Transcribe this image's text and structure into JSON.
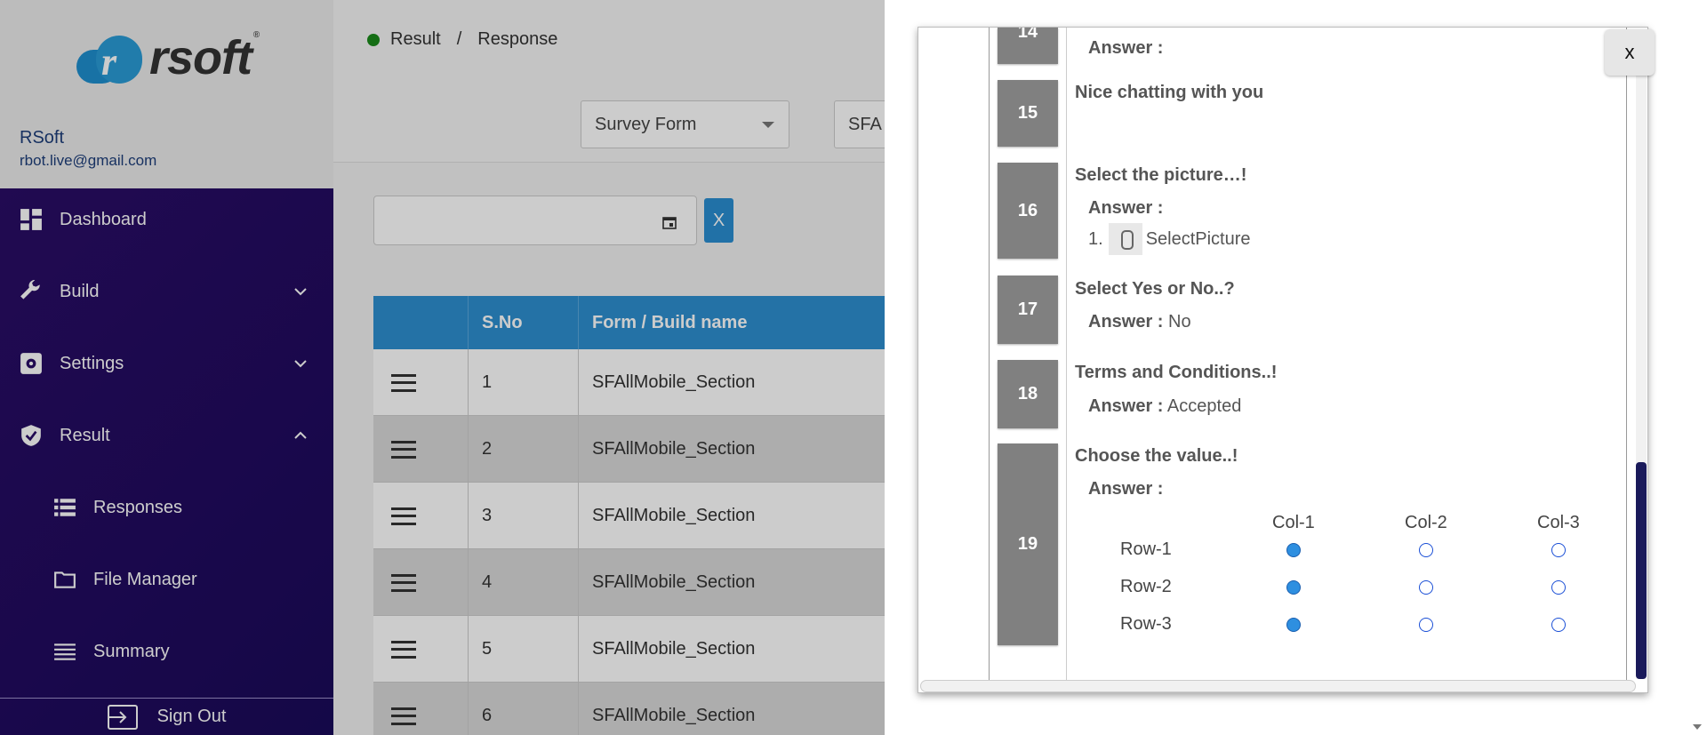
{
  "sidebar": {
    "logo_text": "rsoft",
    "logo_letter": "r",
    "logo_reg": "®",
    "user_name": "RSoft",
    "user_email": "rbot.live@gmail.com",
    "items": [
      {
        "label": "Dashboard",
        "icon": "dashboard-icon"
      },
      {
        "label": "Build",
        "icon": "wrench-icon",
        "chevron": "down"
      },
      {
        "label": "Settings",
        "icon": "gear-icon",
        "chevron": "down"
      },
      {
        "label": "Result",
        "icon": "shield-icon",
        "chevron": "up"
      }
    ],
    "sub_items": [
      {
        "label": "Responses",
        "icon": "table-icon"
      },
      {
        "label": "File Manager",
        "icon": "folder-icon"
      },
      {
        "label": "Summary",
        "icon": "list-icon"
      }
    ],
    "signout_label": "Sign Out",
    "accent": "#2a0d66"
  },
  "breadcrumb": {
    "root": "Result",
    "separator": "/",
    "current": "Response"
  },
  "filters": {
    "form_type": "Survey Form",
    "form_name": "SFA",
    "clear_label": "X"
  },
  "table": {
    "headers": [
      "",
      "S.No",
      "Form / Build name"
    ],
    "rows": [
      {
        "sno": "1",
        "name": "SFAllMobile_Section"
      },
      {
        "sno": "2",
        "name": "SFAllMobile_Section"
      },
      {
        "sno": "3",
        "name": "SFAllMobile_Section"
      },
      {
        "sno": "4",
        "name": "SFAllMobile_Section"
      },
      {
        "sno": "5",
        "name": "SFAllMobile_Section"
      },
      {
        "sno": "6",
        "name": "SFAllMobile_Section"
      }
    ],
    "header_color": "#2e8fd0"
  },
  "modal": {
    "close_label": "x",
    "questions": [
      {
        "num": "14",
        "answer_label": "Answer :"
      },
      {
        "num": "15",
        "title": "Nice chatting with you"
      },
      {
        "num": "16",
        "title": "Select the picture…!",
        "answer_label": "Answer :",
        "option_index": "1.",
        "option_text": "SelectPicture"
      },
      {
        "num": "17",
        "title": "Select Yes or No..?",
        "answer_label": "Answer :",
        "answer_value": "No"
      },
      {
        "num": "18",
        "title": "Terms and Conditions..!",
        "answer_label": "Answer :",
        "answer_value": "Accepted"
      },
      {
        "num": "19",
        "title": "Choose the value..!",
        "answer_label": "Answer :"
      }
    ],
    "grid": {
      "columns": [
        "Col-1",
        "Col-2",
        "Col-3"
      ],
      "rows": [
        "Row-1",
        "Row-2",
        "Row-3"
      ],
      "selected_column": "Col-1"
    }
  }
}
